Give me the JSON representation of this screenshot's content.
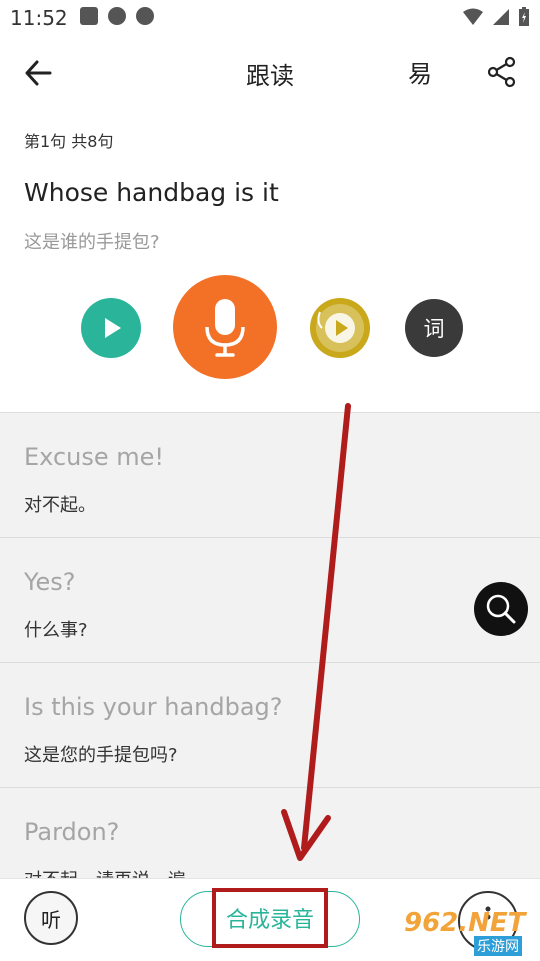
{
  "status_bar": {
    "time": "11:52"
  },
  "app_bar": {
    "title": "跟读",
    "easy_label": "易"
  },
  "lesson": {
    "sentence_count": "第1句 共8句",
    "english": "Whose handbag is it",
    "chinese": "这是谁的手提包?"
  },
  "controls": {
    "word_label": "词"
  },
  "list": [
    {
      "english": "Excuse me!",
      "chinese": "对不起。"
    },
    {
      "english": "Yes?",
      "chinese": "什么事?"
    },
    {
      "english": "Is this your handbag?",
      "chinese": "这是您的手提包吗?"
    },
    {
      "english": "Pardon?",
      "chinese": "对不起，请再说一遍。"
    }
  ],
  "bottom_bar": {
    "listen_label": "听",
    "synth_label": "合成录音"
  },
  "watermark": {
    "main": "962.NET",
    "sub": "乐游网"
  },
  "colors": {
    "accent": "#2ab59a",
    "record": "#f27127",
    "annotation": "#b01c1c"
  }
}
